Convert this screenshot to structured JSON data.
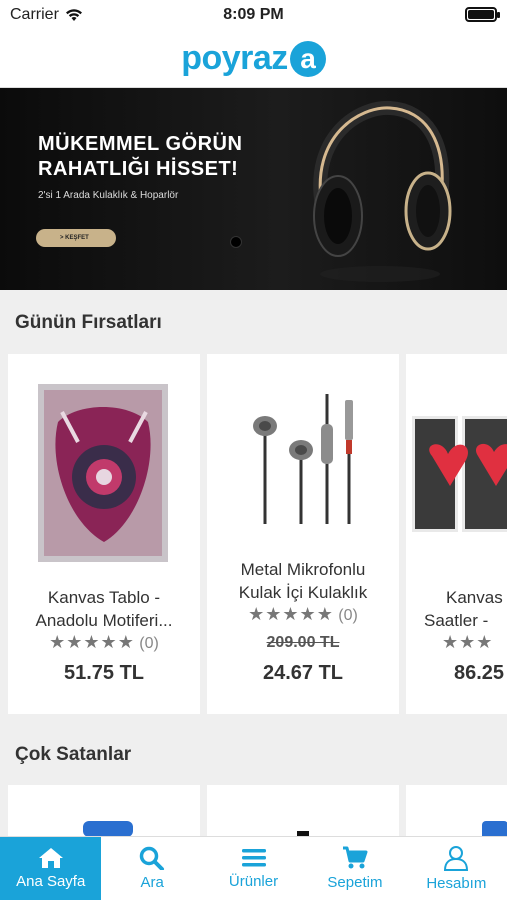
{
  "status": {
    "carrier": "Carrier",
    "time": "8:09 PM"
  },
  "brand": {
    "logo_text": "poyraz",
    "logo_badge": "a"
  },
  "banner": {
    "headline_1": "MÜKEMMEL GÖRÜN",
    "headline_2": "RAHATLIĞI HİSSET!",
    "subtitle": "2'si 1 Arada Kulaklık & Hoparlör",
    "cta": "> KEŞFET"
  },
  "sections": {
    "deals_title": "Günün Fırsatları",
    "bestsellers_title": "Çok Satanlar"
  },
  "deals": [
    {
      "name_1": "Kanvas Tablo -",
      "name_2": "Anadolu Motiferi...",
      "stars": "★★★★★",
      "reviews": "(0)",
      "price": "51.75 TL"
    },
    {
      "name_1": "Metal Mikrofonlu",
      "name_2": "Kulak İçi Kulaklık",
      "stars": "★★★★★",
      "reviews": "(0)",
      "old_price": "209.00 TL",
      "price": "24.67 TL"
    },
    {
      "name_1": "Kanvas",
      "name_2": "Saatler -",
      "stars": "★★★",
      "price": "86.25"
    }
  ],
  "tabs": [
    {
      "label": "Ana Sayfa",
      "icon": "home-icon"
    },
    {
      "label": "Ara",
      "icon": "search-icon"
    },
    {
      "label": "Ürünler",
      "icon": "menu-icon"
    },
    {
      "label": "Sepetim",
      "icon": "cart-icon"
    },
    {
      "label": "Hesabım",
      "icon": "user-icon"
    }
  ],
  "colors": {
    "accent": "#1aa3d9",
    "banner_cta": "#c8b28a"
  }
}
